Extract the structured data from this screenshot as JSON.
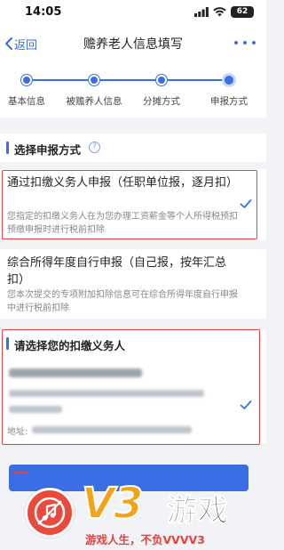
{
  "status_bar": {
    "time": "14:05",
    "battery": "62"
  },
  "nav": {
    "back_label": "返回",
    "title": "赡养老人信息填写"
  },
  "steps": [
    {
      "label": "基本信息"
    },
    {
      "label": "被赡养人信息"
    },
    {
      "label": "分摊方式"
    },
    {
      "label": "申报方式"
    }
  ],
  "current_step": 4,
  "section_filing": {
    "title": "选择申报方式"
  },
  "options": [
    {
      "title": "通过扣缴义务人申报（任职单位报，逐月扣）",
      "description": "您指定的扣缴义务人在为您办理工资薪金等个人所得税预扣预缴申报时进行税前扣除",
      "selected": true
    },
    {
      "title": "综合所得年度自行申报（自己报，按年汇总扣）",
      "description": "您本次提交的专项附加扣除信息可在综合所得年度自行申报中进行税前扣除",
      "selected": false
    }
  ],
  "section_agent": {
    "title": "请选择您的扣缴义务人"
  },
  "agent_card": {
    "address_label": "地址:",
    "selected": true
  },
  "watermark": {
    "brand": "V3",
    "name": "游戏",
    "slogan": "游戏人生，不负VVVV3"
  },
  "colors": {
    "accent": "#3b6ee5",
    "highlight": "#e8413d",
    "watermark_orange": "#f0a31b"
  }
}
